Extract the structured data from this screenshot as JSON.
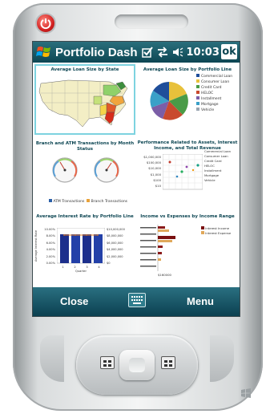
{
  "titlebar": {
    "title": "Portfolio Dash",
    "time": "10:03",
    "ok_label": "ok"
  },
  "panels": [
    {
      "title": "Average Loan Size by State"
    },
    {
      "title": "Average Loan Size by Portfolio Line",
      "legend": [
        "Commercial Loan",
        "Consumer Loan",
        "Credit Card",
        "HELOC",
        "Installment",
        "Mortgage",
        "Vehicle"
      ],
      "colors": [
        "#1f4e9a",
        "#e8c13b",
        "#4a9b47",
        "#c94a2e",
        "#7b5ea7",
        "#3aa0c8",
        "#9aa5b0"
      ]
    },
    {
      "title": "Branch and ATM Transactions by Month Status",
      "legend": [
        "ATM Transactions",
        "Branch Transactions"
      ]
    },
    {
      "title": "Performance Related to Assets, Interest Income, and Total Revenue",
      "y_labels": [
        "$1,000,000",
        "$100,000",
        "$10,000",
        "$1,000",
        "$100",
        "$10"
      ],
      "legend": [
        "Commercial Loan",
        "Consumer Loan",
        "Credit Card",
        "HELOC",
        "Installment",
        "Mortgage",
        "Vehicle"
      ]
    },
    {
      "title": "Average Interest Rate by Portfolio Line",
      "y_labels": [
        "10.00%",
        "8.00%",
        "6.00%",
        "4.00%",
        "2.00%",
        "0.00%"
      ],
      "y2_labels": [
        "$10,000,000",
        "$8,000,000",
        "$6,000,000",
        "$4,000,000",
        "$2,000,000",
        "$0"
      ],
      "y_title": "Average Interest Rate",
      "x_title": "Quarter",
      "x_labels": [
        "1",
        "2",
        "3",
        "4"
      ]
    },
    {
      "title": "Income vs Expenses by Income Range",
      "legend": [
        "Interest Income",
        "Interest Expense"
      ],
      "x_label": "$160000"
    }
  ],
  "bottombar": {
    "left": "Close",
    "right": "Menu"
  },
  "colors": {
    "accent": "#0d4653",
    "selection": "#7dd3e0",
    "power": "#d32020"
  }
}
